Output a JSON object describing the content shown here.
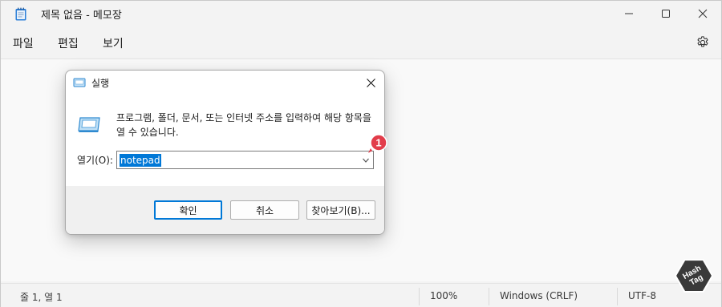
{
  "notepad": {
    "title": "제목 없음 - 메모장",
    "menu": [
      {
        "label": "파일"
      },
      {
        "label": "편집"
      },
      {
        "label": "보기"
      }
    ],
    "status": {
      "position": "줄 1, 열 1",
      "zoom": "100%",
      "line_ending": "Windows (CRLF)",
      "encoding": "UTF-8"
    }
  },
  "run_dialog": {
    "title": "실행",
    "description": "프로그램, 폴더, 문서, 또는 인터넷 주소를 입력하여 해당 항목을 열 수 있습니다.",
    "open_label": "열기(O):",
    "input_value": "notepad",
    "buttons": {
      "ok": "확인",
      "cancel": "취소",
      "browse": "찾아보기(B)..."
    }
  },
  "callout": {
    "number": "1",
    "color": "#e23c4a"
  },
  "watermark": {
    "text_line1": "Hash",
    "text_line2": "Tag"
  },
  "colors": {
    "accent": "#0078d7",
    "window_bg": "#f3f3f3",
    "editor_bg": "#f9f9f9"
  }
}
